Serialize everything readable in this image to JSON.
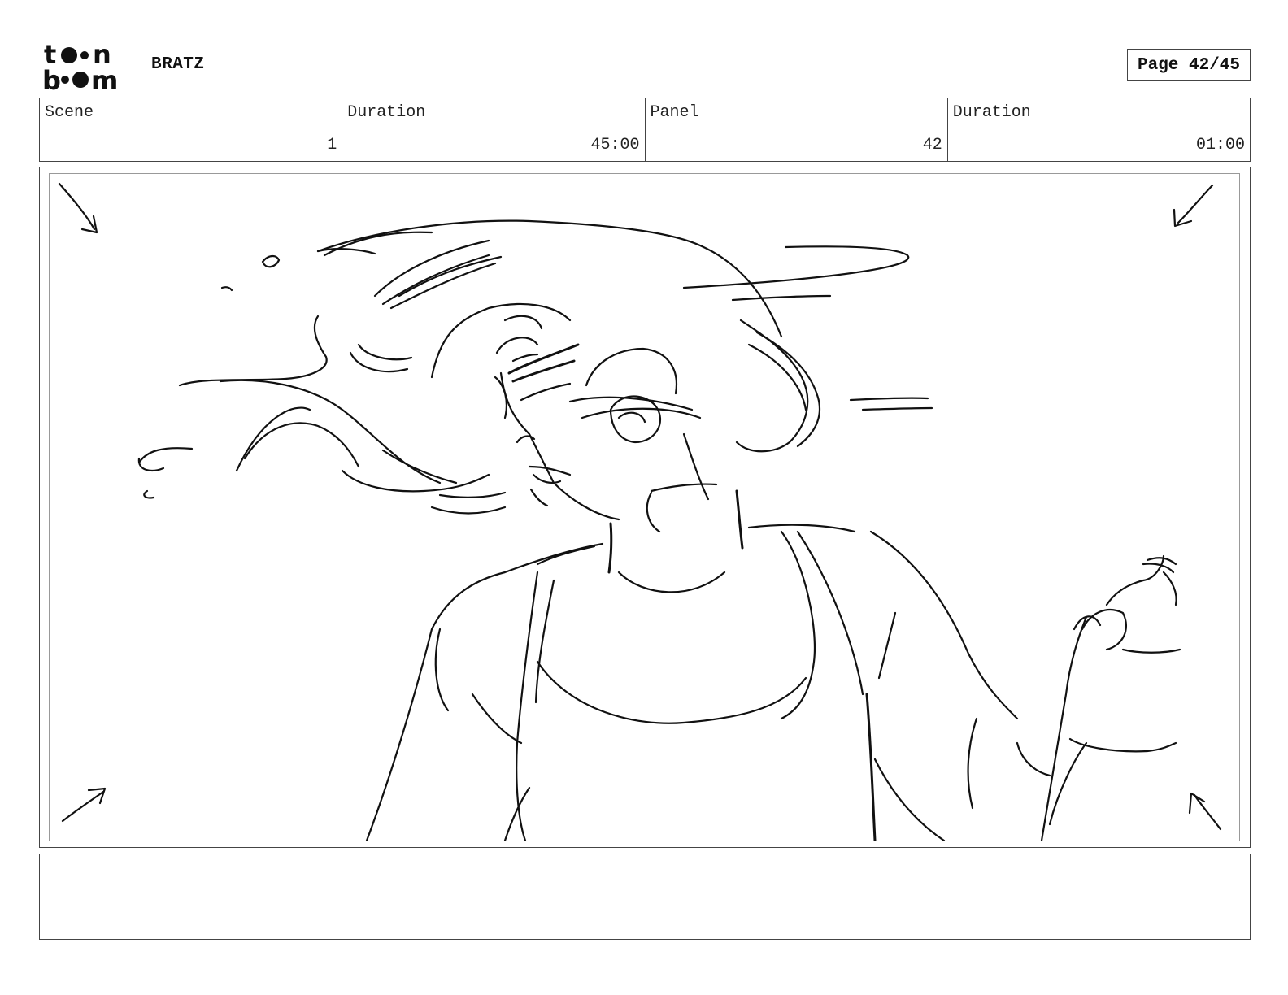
{
  "header": {
    "logo_text": [
      "t",
      "n",
      "b",
      "m"
    ],
    "project_title": "BRATZ",
    "page_label": "Page 42/45"
  },
  "info": {
    "scene_label": "Scene",
    "scene_value": "1",
    "scene_duration_label": "Duration",
    "scene_duration_value": "45:00",
    "panel_label": "Panel",
    "panel_value": "42",
    "panel_duration_label": "Duration",
    "panel_duration_value": "01:00"
  },
  "notes": {
    "text": ""
  }
}
